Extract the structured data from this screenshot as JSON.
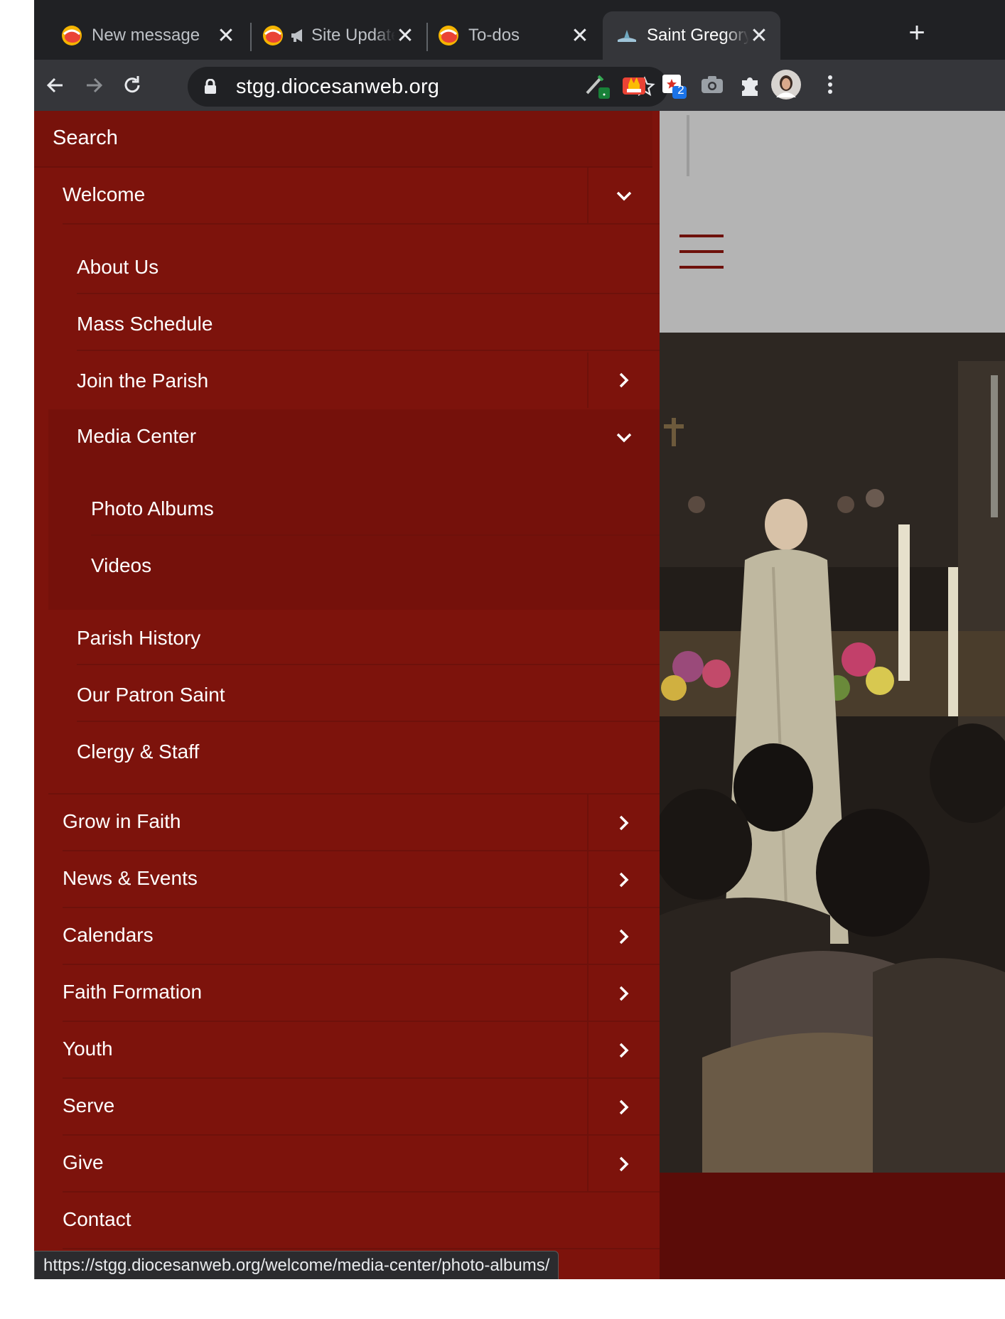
{
  "browser": {
    "tabs": [
      {
        "title": "New message",
        "favicon": "mail-app-icon",
        "active": false
      },
      {
        "title": "Site Update",
        "favicon": "mail-app-icon",
        "active": false
      },
      {
        "title": "To-dos",
        "favicon": "mail-app-icon",
        "active": false
      },
      {
        "title": "Saint Gregory t",
        "favicon": "church-icon",
        "active": true
      }
    ],
    "url": "stgg.diocesanweb.org",
    "extension_badge": "2",
    "status_url": "https://stgg.diocesanweb.org/welcome/media-center/photo-albums/"
  },
  "nav": {
    "search_label": "Search",
    "welcome": "Welcome",
    "welcome_children": [
      "About Us",
      "Mass Schedule",
      "Join the Parish",
      "Media Center"
    ],
    "media_children": [
      "Photo Albums",
      "Videos"
    ],
    "welcome_children_after": [
      "Parish History",
      "Our Patron Saint",
      "Clergy & Staff"
    ],
    "top_items": [
      "Grow in Faith",
      "News & Events",
      "Calendars",
      "Faith Formation",
      "Youth",
      "Serve",
      "Give",
      "Contact"
    ]
  },
  "colors": {
    "drawer_bg": "#7d130c",
    "submenu_bg": "#75110b",
    "accent": "#6e110b"
  }
}
